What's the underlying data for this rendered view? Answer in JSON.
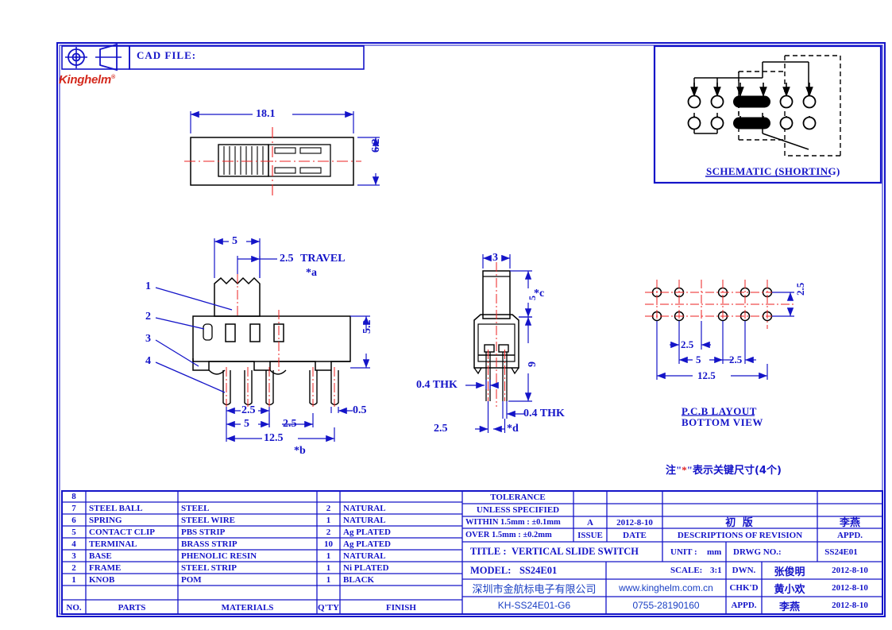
{
  "sheet": {
    "projection_symbol": "first-angle-projection-icon",
    "cad_file_label": "CAD  FILE:",
    "brand": "Kinghelm",
    "brand_tm": "®"
  },
  "views": {
    "top_view": {
      "name": "top-view",
      "dims": [
        {
          "label": "18.1",
          "kind": "horizontal-overall"
        },
        {
          "label": "6.2",
          "kind": "vertical-overall"
        }
      ]
    },
    "front_view": {
      "name": "front-view",
      "dims": [
        {
          "label": "5",
          "kind": "knob-width"
        },
        {
          "label": "2.5",
          "kind": "travel"
        },
        {
          "label": "TRAVEL",
          "kind": "travel-text"
        },
        {
          "label": "*a",
          "kind": "critical-mark"
        },
        {
          "label": "5.2",
          "kind": "body-height"
        },
        {
          "label": "2.5",
          "kind": "pin-pitch"
        },
        {
          "label": "5",
          "kind": "pin-span"
        },
        {
          "label": "2.5",
          "kind": "pin-pitch-2"
        },
        {
          "label": "0.5",
          "kind": "pin-width"
        },
        {
          "label": "12.5",
          "kind": "pin-overall"
        },
        {
          "label": "*b",
          "kind": "critical-mark"
        }
      ],
      "balloons": [
        "1",
        "2",
        "3",
        "4"
      ]
    },
    "side_view": {
      "name": "side-view",
      "dims": [
        {
          "label": "3",
          "kind": "knob-thickness"
        },
        {
          "label": "5",
          "kind": "knob-height"
        },
        {
          "label": "*c",
          "kind": "critical-mark"
        },
        {
          "label": "9",
          "kind": "overall-height"
        },
        {
          "label": "0.4 THK",
          "kind": "terminal-thickness-left"
        },
        {
          "label": "0.4  THK",
          "kind": "terminal-thickness-right"
        },
        {
          "label": "2.5",
          "kind": "terminal-pitch"
        },
        {
          "label": "*d",
          "kind": "critical-mark"
        }
      ]
    },
    "pcb_layout": {
      "name": "pcb-layout",
      "title_line1": "P.C.B  LAYOUT",
      "title_line2": "BOTTOM  VIEW",
      "dims": [
        {
          "label": "2.5",
          "kind": "row-spacing"
        },
        {
          "label": "2.5",
          "kind": "hole-pitch-1"
        },
        {
          "label": "5",
          "kind": "hole-span"
        },
        {
          "label": "2.5",
          "kind": "hole-pitch-2"
        },
        {
          "label": "12.5",
          "kind": "hole-overall"
        }
      ],
      "rows": 2,
      "holes_per_row": 5
    },
    "schematic": {
      "name": "schematic",
      "title": "SCHEMATIC  (SHORTING)",
      "terminals_per_row": 6,
      "rows": 2
    }
  },
  "note": {
    "prefix": "注",
    "quote_open": "\"",
    "star": "*",
    "quote_close": "\"",
    "text": "表示关键尺寸(4个)"
  },
  "bom": {
    "headers": [
      "NO.",
      "PARTS",
      "MATERIALS",
      "Q'TY",
      "FINISH"
    ],
    "rows": [
      {
        "no": "8",
        "part": "",
        "material": "",
        "qty": "",
        "finish": ""
      },
      {
        "no": "7",
        "part": "STEEL BALL",
        "material": "STEEL",
        "qty": "2",
        "finish": "NATURAL"
      },
      {
        "no": "6",
        "part": "SPRING",
        "material": "STEEL WIRE",
        "qty": "1",
        "finish": "NATURAL"
      },
      {
        "no": "5",
        "part": "CONTACT CLIP",
        "material": "PBS STRIP",
        "qty": "2",
        "finish": "Ag PLATED"
      },
      {
        "no": "4",
        "part": "TERMINAL",
        "material": "BRASS STRIP",
        "qty": "10",
        "finish": "Ag PLATED"
      },
      {
        "no": "3",
        "part": "BASE",
        "material": "PHENOLIC RESIN",
        "qty": "1",
        "finish": "NATURAL"
      },
      {
        "no": "2",
        "part": "FRAME",
        "material": "STEEL STRIP",
        "qty": "1",
        "finish": "Ni PLATED"
      },
      {
        "no": "1",
        "part": "KNOB",
        "material": "POM",
        "qty": "1",
        "finish": "BLACK"
      }
    ]
  },
  "titleblock": {
    "tolerance_line1": "TOLERANCE",
    "tolerance_line2": "UNLESS   SPECIFIED",
    "tol_within": "WITHIN  1.5mm :  ±0.1mm",
    "tol_over": "OVER 1.5mm :  ±0.2mm",
    "issue_value": "A",
    "issue_label": "ISSUE",
    "date_value": "2012-8-10",
    "date_label": "DATE",
    "revision_desc_cn": "初    版",
    "revision_label": "DESCRIPTIONS  OF  REVISION",
    "appd_header_cn": "李燕",
    "appd_header_label": "APPD.",
    "title_label": "TITLE :",
    "title_value": "VERTICAL  SLIDE  SWITCH",
    "model_label": "MODEL:",
    "model_value": "SS24E01",
    "unit_label": "UNIT :",
    "unit_value": "mm",
    "scale_label": "SCALE:",
    "scale_value": "3:1",
    "drwg_label": "DRWG  NO.:",
    "drwg_value": "SS24E01",
    "company_cn": "深圳市金航标电子有限公司",
    "website": "www.kinghelm.com.cn",
    "part_number": "KH-SS24E01-G6",
    "phone": "0755-28190160",
    "signoff": [
      {
        "role": "DWN.",
        "name": "张俊明",
        "date": "2012-8-10"
      },
      {
        "role": "CHK'D",
        "name": "黄小欢",
        "date": "2012-8-10"
      },
      {
        "role": "APPD.",
        "name": "李燕",
        "date": "2012-8-10"
      }
    ]
  },
  "colors": {
    "line": "#1414c8",
    "center": "#ee2222",
    "brand": "#d42a1e",
    "black": "#000000"
  }
}
